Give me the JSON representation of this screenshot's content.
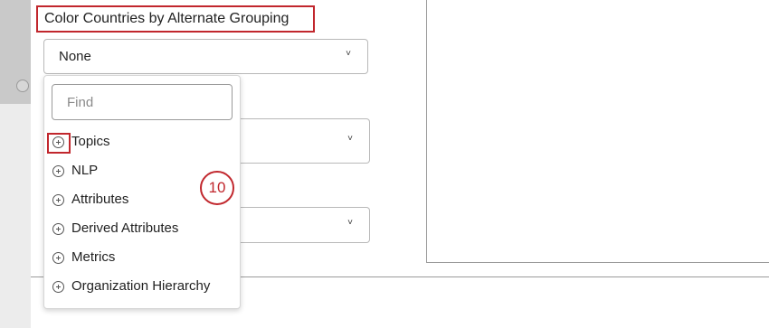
{
  "panel": {
    "heading": "Color Countries by Alternate Grouping"
  },
  "select1": {
    "value": "None",
    "chevron": "˅"
  },
  "select2": {
    "chevron": "˅"
  },
  "select3": {
    "chevron": "˅"
  },
  "dropdown": {
    "find_placeholder": "Find",
    "items": [
      {
        "label": "Topics",
        "icon": "plus-circle-icon"
      },
      {
        "label": "NLP",
        "icon": "plus-circle-icon"
      },
      {
        "label": "Attributes",
        "icon": "plus-circle-icon"
      },
      {
        "label": "Derived Attributes",
        "icon": "plus-circle-icon"
      },
      {
        "label": "Metrics",
        "icon": "plus-circle-icon"
      },
      {
        "label": "Organization Hierarchy",
        "icon": "plus-circle-icon"
      }
    ]
  },
  "annotation": {
    "step": "10"
  },
  "colors": {
    "highlight": "#c1272d",
    "border": "#b8b8b8"
  }
}
